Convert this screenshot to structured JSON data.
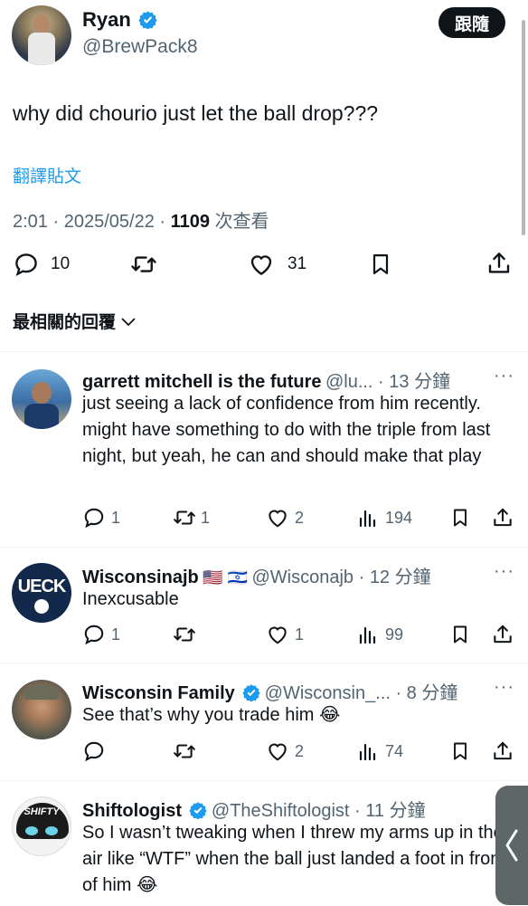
{
  "post": {
    "author_name": "Ryan",
    "author_handle": "@BrewPack8",
    "follow_label": "跟隨",
    "text": "why did chourio just let the ball drop???",
    "translate_label": "翻譯貼文",
    "time": "2:01",
    "date": "2025/05/22",
    "views_count": "1109",
    "views_label": "次查看",
    "reply_count": "10",
    "like_count": "31"
  },
  "sort": {
    "label": "最相關的回覆"
  },
  "replies": [
    {
      "name": "garrett mitchell is the future",
      "handle": "@lu...",
      "time": "13 分鐘",
      "text": "just seeing a lack of confidence from him recently. might have something to do with the triple from last night, but yeah, he can and should make that play",
      "replies": "1",
      "reposts": "1",
      "likes": "2",
      "views": "194"
    },
    {
      "name": "Wisconsinajb",
      "flags": "🇺🇸 🇮🇱",
      "handle": "@Wisconajb",
      "time": "12 分鐘",
      "text": "Inexcusable",
      "replies": "1",
      "reposts": "",
      "likes": "1",
      "views": "99",
      "avatar_text": "UECK"
    },
    {
      "name": "Wisconsin Family",
      "handle": "@Wisconsin_...",
      "time": "8 分鐘",
      "text": "See that’s why you trade him 😂",
      "replies": "",
      "reposts": "",
      "likes": "2",
      "views": "74"
    },
    {
      "name": "Shiftologist",
      "handle": "@TheShiftologist",
      "time": "11 分鐘",
      "text": "So I wasn’t tweaking when I threw my arms up in the air like “WTF” when the ball just landed a foot in front of him 😂",
      "avatar_text": "SHIFTY"
    }
  ],
  "colors": {
    "verified": "#1d9bf0",
    "text": "#0f1419",
    "secondary": "#536471"
  }
}
